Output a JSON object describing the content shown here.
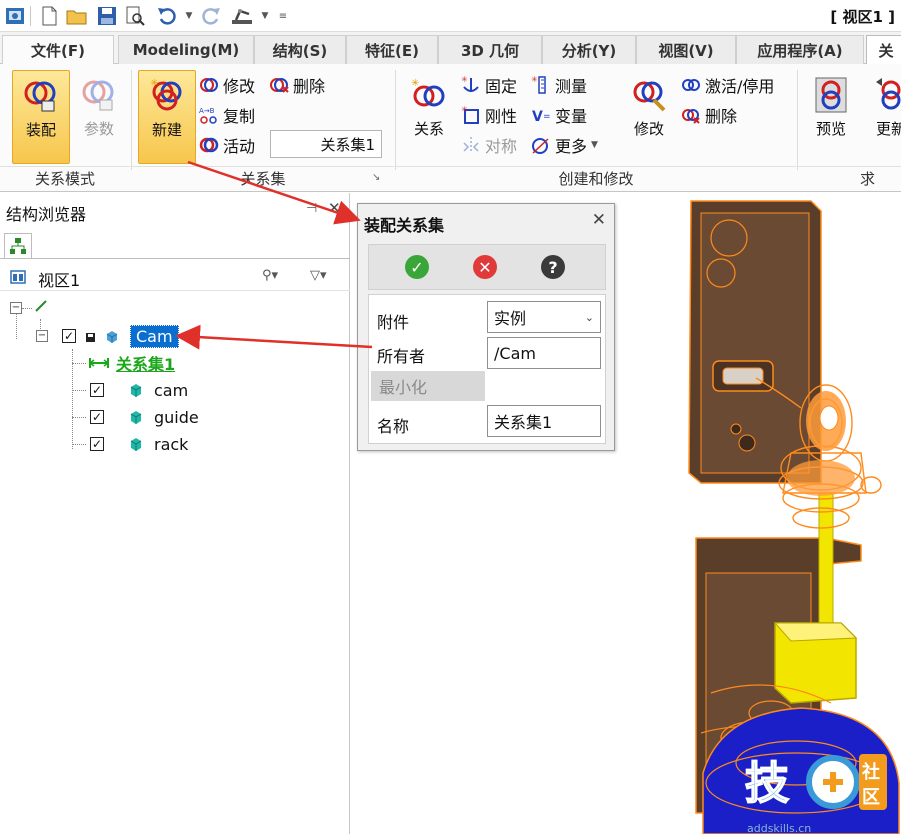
{
  "window": {
    "title": "[ 视区1 ]"
  },
  "quick_access": {
    "icons": [
      "app-icon",
      "new-file-icon",
      "open-folder-icon",
      "save-icon",
      "print-preview-icon",
      "undo-icon",
      "undo-dropdown-icon",
      "redo-icon",
      "robot-arm-icon",
      "robot-dropdown-icon",
      "customize-icon"
    ]
  },
  "tabs": [
    {
      "label": "文件(F)"
    },
    {
      "label": "Modeling(M)"
    },
    {
      "label": "结构(S)"
    },
    {
      "label": "特征(E)"
    },
    {
      "label": "3D 几何"
    },
    {
      "label": "分析(Y)"
    },
    {
      "label": "视图(V)"
    },
    {
      "label": "应用程序(A)"
    },
    {
      "label": "关"
    }
  ],
  "ribbon": {
    "mode_group": {
      "label": "关系模式",
      "assemble": "装配",
      "params": "参数"
    },
    "relset_group": {
      "label": "关系集",
      "new": "新建",
      "modify": "修改",
      "delete": "删除",
      "copy": "复制",
      "active": "活动",
      "current_set": "关系集1"
    },
    "create_group": {
      "label": "创建和修改",
      "relation": "关系",
      "fix": "固定",
      "measure": "测量",
      "rigid": "刚性",
      "variable": "变量",
      "symmetry": "对称",
      "more": "更多",
      "modify": "修改",
      "activate": "激活/停用",
      "delete": "删除"
    },
    "solve_group": {
      "label": "求",
      "preview": "预览",
      "update": "更新"
    }
  },
  "browser": {
    "title": "结构浏览器",
    "view": "视区1",
    "tree": {
      "root_label": "Cam",
      "relset": "关系集1",
      "parts": [
        "cam",
        "guide",
        "rack"
      ]
    }
  },
  "dialog": {
    "title": "装配关系集",
    "fields": {
      "attach_label": "附件",
      "attach_value": "实例",
      "owner_label": "所有者",
      "owner_value": "/Cam",
      "minimize": "最小化",
      "name_label": "名称",
      "name_value": "关系集1"
    }
  },
  "watermark": {
    "site": "addskills.cn"
  },
  "colors": {
    "accent_highlight": "#f7c64c",
    "selection_blue": "#0a6ed1",
    "relset_green": "#1aa81a",
    "arrow_red": "#e0302a",
    "plate_brown": "#5a3e2a",
    "wire_orange": "#ff8a1c",
    "part_yellow": "#f2e600",
    "base_blue": "#1a1fc8"
  }
}
